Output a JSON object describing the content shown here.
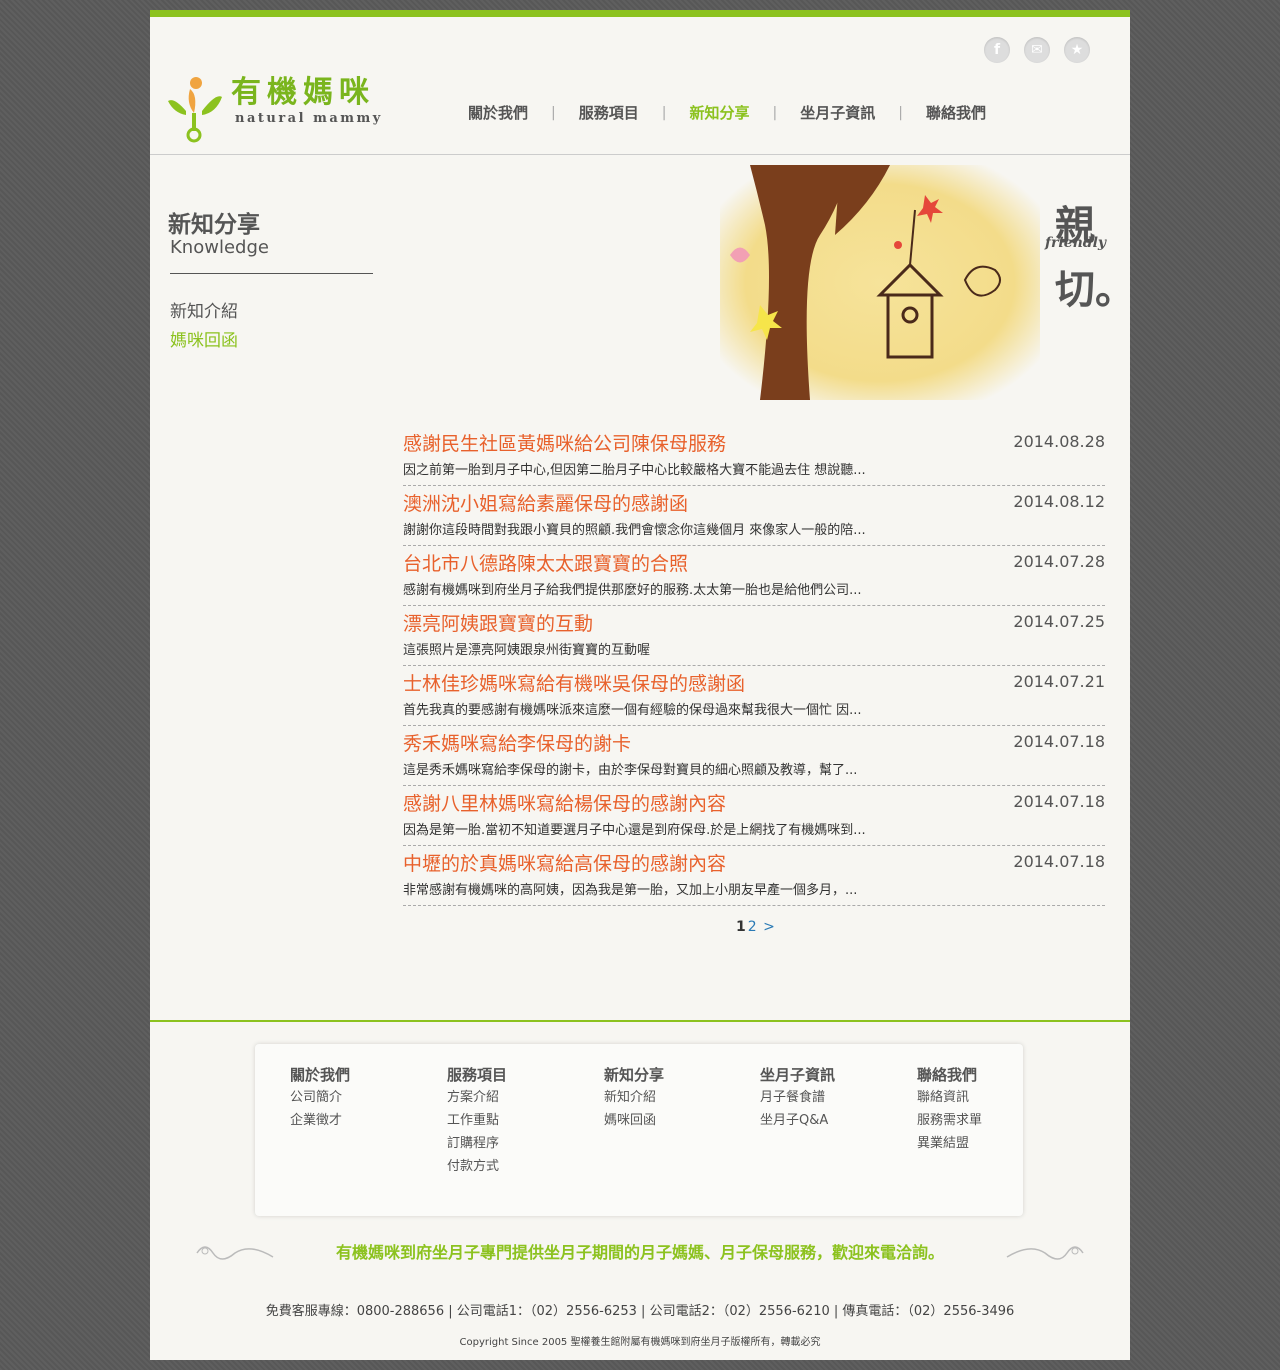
{
  "header": {
    "social": [
      {
        "icon": "facebook-icon",
        "glyph": "f"
      },
      {
        "icon": "mail-icon",
        "glyph": "✉"
      },
      {
        "icon": "star-icon",
        "glyph": "★"
      }
    ],
    "logo": {
      "cn": "有機媽咪",
      "en": "natural mammy"
    },
    "nav": [
      "關於我們",
      "服務項目",
      "新知分享",
      "坐月子資訊",
      "聯絡我們"
    ],
    "active_nav": "新知分享",
    "accent_color": "#8cc21f"
  },
  "sidebar": {
    "title": "新知分享",
    "subtitle": "Knowledge",
    "links": [
      "新知介紹",
      "媽咪回函"
    ],
    "active": "媽咪回函"
  },
  "banner": {
    "char1": "親",
    "friendly": "friendly",
    "char2": "切。"
  },
  "news": [
    {
      "title": "感謝民生社區黃媽咪給公司陳保母服務",
      "date": "2014.08.28",
      "excerpt": "因之前第一胎到月子中心,但因第二胎月子中心比較嚴格大寶不能過去住 想說聽..."
    },
    {
      "title": "澳洲沈小姐寫給素麗保母的感謝函",
      "date": "2014.08.12",
      "excerpt": "謝謝你這段時間對我跟小寶貝的照顧.我們會懷念你這幾個月 來像家人一般的陪..."
    },
    {
      "title": "台北市八德路陳太太跟寶寶的合照",
      "date": "2014.07.28",
      "excerpt": "感謝有機媽咪到府坐月子給我們提供那麼好的服務.太太第一胎也是給他們公司..."
    },
    {
      "title": "漂亮阿姨跟寶寶的互動",
      "date": "2014.07.25",
      "excerpt": "這張照片是漂亮阿姨跟泉州街寶寶的互動喔"
    },
    {
      "title": "士林佳珍媽咪寫給有機咪吳保母的感謝函",
      "date": "2014.07.21",
      "excerpt": "首先我真的要感謝有機媽咪派來這麼一個有經驗的保母過來幫我很大一個忙 因..."
    },
    {
      "title": "秀禾媽咪寫給李保母的謝卡",
      "date": "2014.07.18",
      "excerpt": "這是秀禾媽咪寫給李保母的謝卡，由於李保母對寶貝的細心照顧及教導，幫了..."
    },
    {
      "title": "感謝八里林媽咪寫給楊保母的感謝內容",
      "date": "2014.07.18",
      "excerpt": "因為是第一胎.當初不知道要選月子中心還是到府保母.於是上網找了有機媽咪到..."
    },
    {
      "title": "中壢的於真媽咪寫給高保母的感謝內容",
      "date": "2014.07.18",
      "excerpt": "非常感謝有機媽咪的高阿姨，因為我是第一胎，又加上小朋友早產一個多月，..."
    }
  ],
  "pager": {
    "current": "1",
    "next_page": "2",
    "next": ">"
  },
  "footer": {
    "columns": [
      {
        "head": "關於我們",
        "links": [
          "公司簡介",
          "企業徵才"
        ]
      },
      {
        "head": "服務項目",
        "links": [
          "方案介紹",
          "工作重點",
          "訂購程序",
          "付款方式"
        ]
      },
      {
        "head": "新知分享",
        "links": [
          "新知介紹",
          "媽咪回函"
        ]
      },
      {
        "head": "坐月子資訊",
        "links": [
          "月子餐食譜",
          "坐月子Q&A"
        ]
      },
      {
        "head": "聯絡我們",
        "links": [
          "聯絡資訊",
          "服務需求單",
          "異業結盟"
        ]
      }
    ],
    "slogan": "有機媽咪到府坐月子專門提供坐月子期間的月子媽媽、月子保母服務，歡迎來電洽詢。",
    "contact": "免費客服專線：0800-288656 | 公司電話1：（02）2556-6253 | 公司電話2：（02）2556-6210 | 傳真電話：（02）2556-3496",
    "copyright": "Copyright Since 2005 聖權養生館附屬有機媽咪到府坐月子版權所有，轉載必究"
  }
}
